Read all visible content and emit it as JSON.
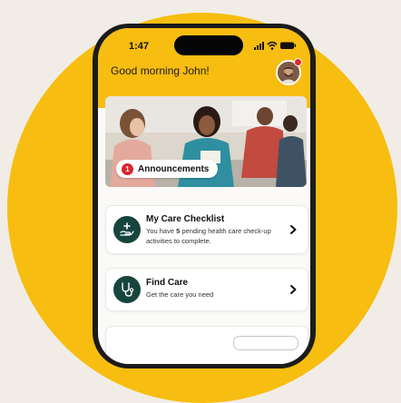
{
  "status_bar": {
    "time": "1:47"
  },
  "header": {
    "greeting": "Good morning John!"
  },
  "hero": {
    "announcements_label": "Announcements",
    "announcements_count": "1"
  },
  "cards": [
    {
      "title": "My Care Checklist",
      "desc_prefix": "You have ",
      "desc_count": "5",
      "desc_suffix": " pending health care check-up activities to complete."
    },
    {
      "title": "Find Care",
      "desc": "Get the care you need"
    }
  ],
  "colors": {
    "accent_yellow": "#f7bd10",
    "icon_green": "#17453e",
    "notification_red": "#d9252e"
  },
  "icons": [
    "signal-icon",
    "wifi-icon",
    "battery-icon",
    "checklist-hand-icon",
    "stethoscope-icon",
    "chevron-right-icon"
  ]
}
